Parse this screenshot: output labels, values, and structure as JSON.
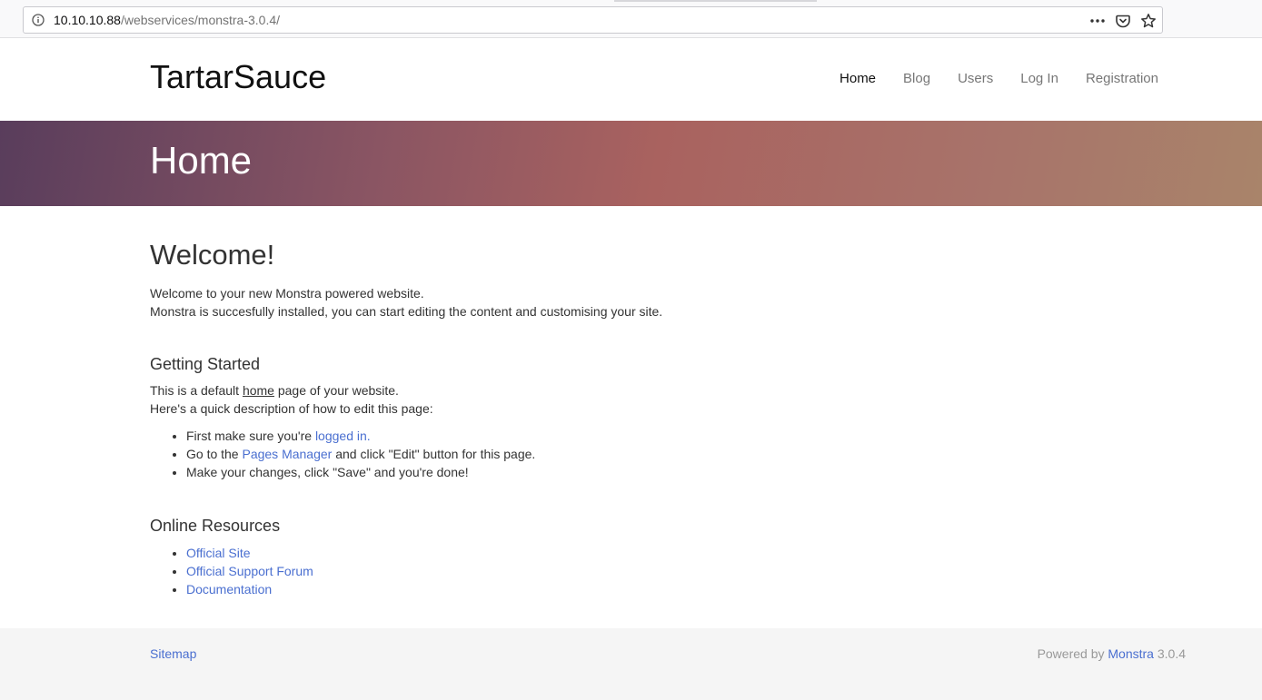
{
  "browser": {
    "url_host": "10.10.10.88",
    "url_path": "/webservices/monstra-3.0.4/",
    "icons": [
      "info-icon",
      "more-icon",
      "pocket-icon",
      "bookmark-star-icon"
    ]
  },
  "header": {
    "brand": "TartarSauce",
    "nav": [
      {
        "label": "Home",
        "active": true
      },
      {
        "label": "Blog"
      },
      {
        "label": "Users"
      },
      {
        "label": "Log In"
      },
      {
        "label": "Registration"
      }
    ]
  },
  "hero": {
    "title": "Home"
  },
  "main": {
    "welcome_title": "Welcome!",
    "welcome_line1": "Welcome to your new Monstra powered website.",
    "welcome_line2": "Monstra is succesfully installed, you can start editing the content and customising your site.",
    "getting_started_title": "Getting Started",
    "gs_line1_pre": "This is a default ",
    "gs_line1_link": "home",
    "gs_line1_post": " page of your website.",
    "gs_line2": "Here's a quick description of how to edit this page:",
    "steps": {
      "s1_pre": "First make sure you're ",
      "s1_link": "logged in.",
      "s2_pre": "Go to the ",
      "s2_link": "Pages Manager",
      "s2_post": " and click \"Edit\" button for this page.",
      "s3": "Make your changes, click \"Save\" and you're done!"
    },
    "online_resources_title": "Online Resources",
    "resources": [
      "Official Site",
      "Official Support Forum",
      "Documentation"
    ]
  },
  "footer": {
    "sitemap": "Sitemap",
    "powered_pre": "Powered by ",
    "powered_link": "Monstra",
    "powered_version": " 3.0.4"
  },
  "colors": {
    "link": "#4a6fd0",
    "hero_gradient": [
      "#593d5c",
      "#a9625f",
      "#a9846a"
    ]
  }
}
